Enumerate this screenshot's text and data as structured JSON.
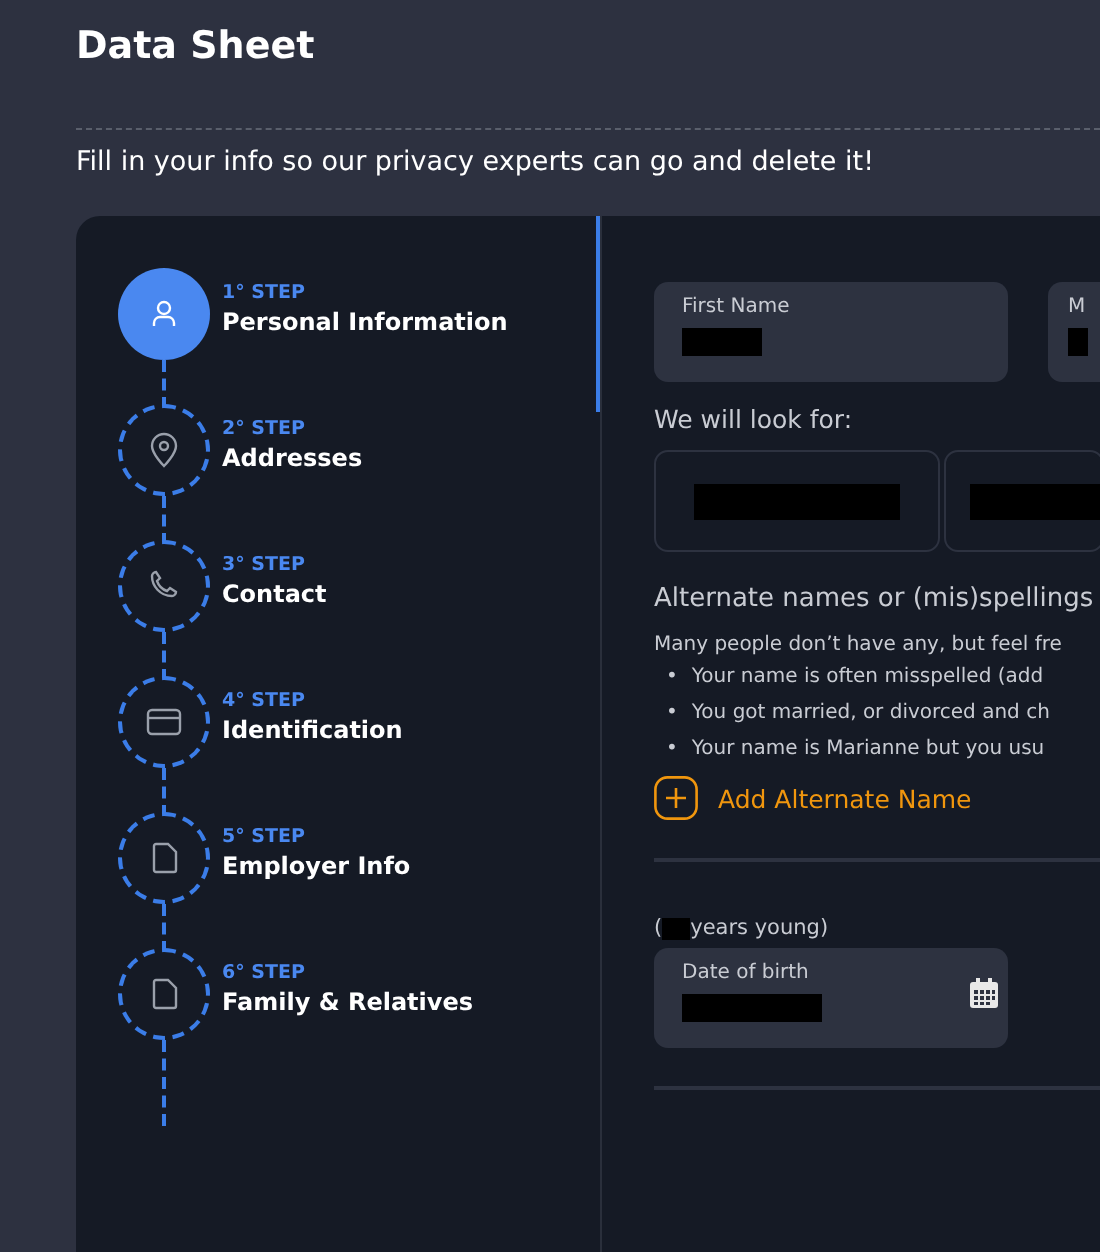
{
  "header": {
    "title": "Data Sheet",
    "subtitle": "Fill in your info so our privacy experts can go and delete it!"
  },
  "steps": [
    {
      "step": "1° STEP",
      "title": "Personal Information",
      "selected": true
    },
    {
      "step": "2° STEP",
      "title": "Addresses",
      "selected": false
    },
    {
      "step": "3° STEP",
      "title": "Contact",
      "selected": false
    },
    {
      "step": "4° STEP",
      "title": "Identification",
      "selected": false
    },
    {
      "step": "5° STEP",
      "title": "Employer Info",
      "selected": false
    },
    {
      "step": "6° STEP",
      "title": "Family & Relatives",
      "selected": false
    }
  ],
  "name_fields": [
    {
      "label": "First Name"
    },
    {
      "label": "M"
    }
  ],
  "look_for": {
    "label": "We will look for:"
  },
  "alternate": {
    "title": "Alternate names or (mis)spellings",
    "intro": "Many people don’t have any, but feel fre",
    "bullets": [
      {
        "marker": "•",
        "text": "Your name is often misspelled (add"
      },
      {
        "marker": "•",
        "text": "You got married, or divorced and ch"
      },
      {
        "marker": "•",
        "text": "Your name is Marianne but you usu"
      }
    ],
    "add_button": "Add Alternate Name"
  },
  "birth": {
    "age_open": "(",
    "age_close": "years young)",
    "label": "Date of birth"
  }
}
